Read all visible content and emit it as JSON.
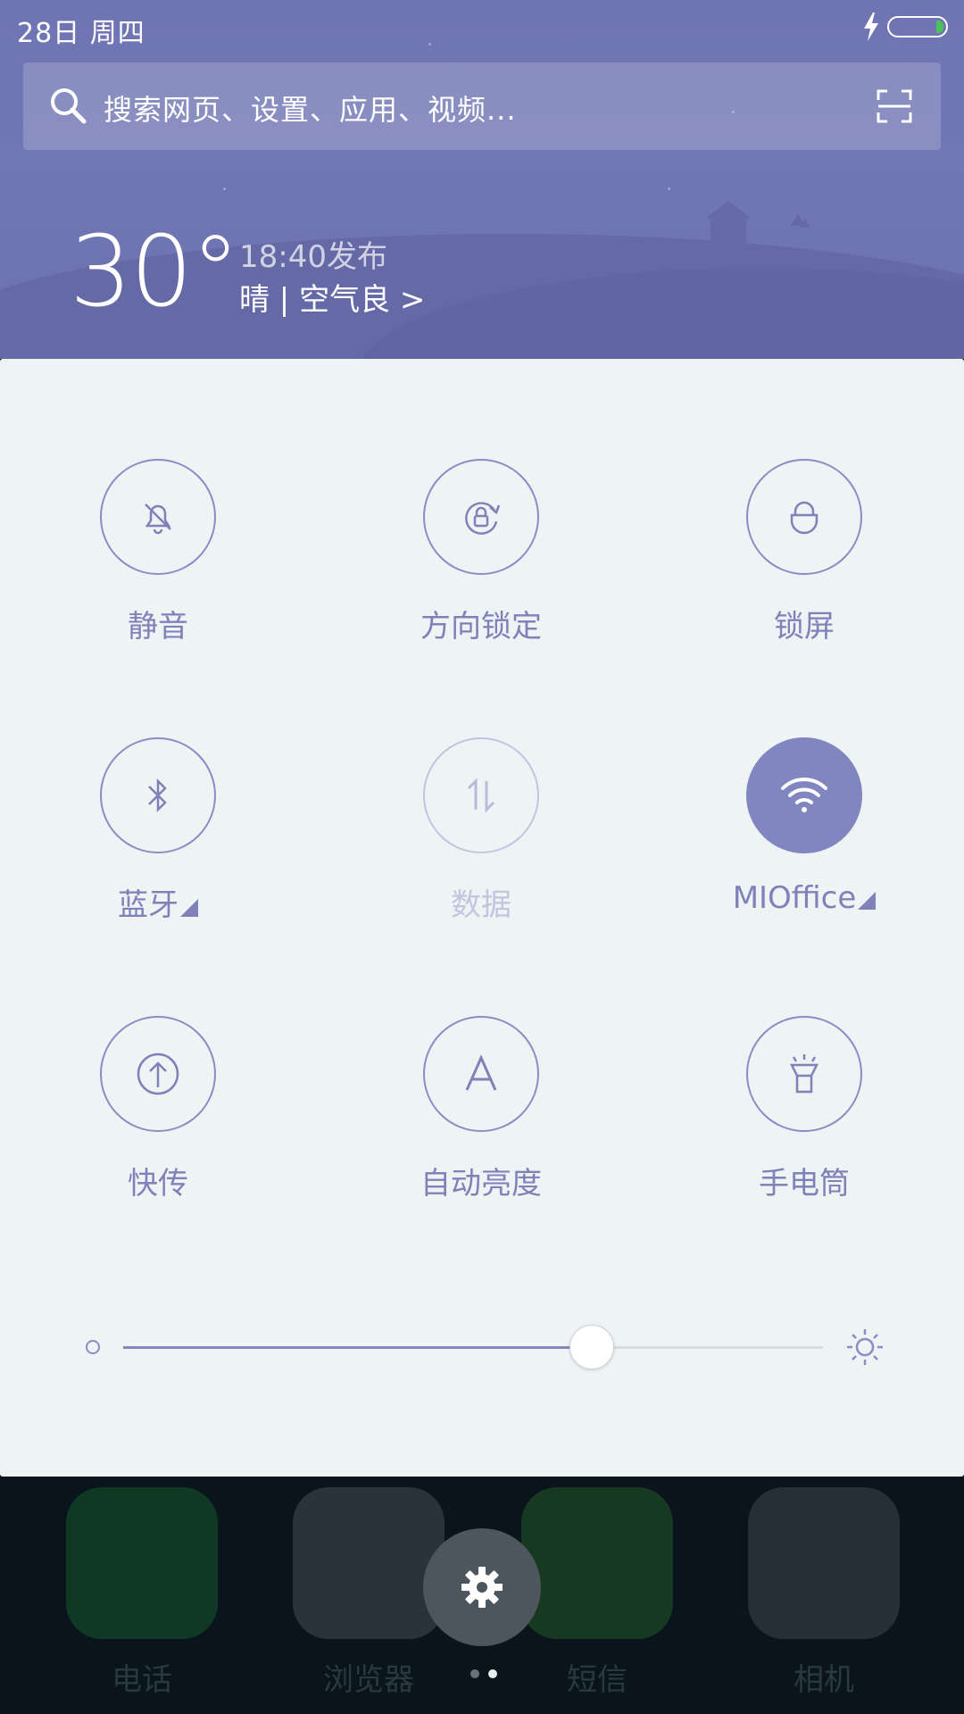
{
  "status_bar": {
    "date": "28日 周四"
  },
  "search": {
    "placeholder": "搜索网页、设置、应用、视频..."
  },
  "weather": {
    "temperature": "30°",
    "publish_time": "18:40发布",
    "condition": "晴 | 空气良 >"
  },
  "toggles": [
    {
      "label": "静音",
      "icon": "bell-off-icon",
      "state": "off"
    },
    {
      "label": "方向锁定",
      "icon": "rotation-lock-icon",
      "state": "off"
    },
    {
      "label": "锁屏",
      "icon": "lock-icon",
      "state": "off"
    },
    {
      "label": "蓝牙",
      "icon": "bluetooth-icon",
      "state": "off"
    },
    {
      "label": "数据",
      "icon": "mobile-data-icon",
      "state": "disabled"
    },
    {
      "label": "MIOffice",
      "icon": "wifi-icon",
      "state": "on"
    },
    {
      "label": "快传",
      "icon": "upload-icon",
      "state": "off"
    },
    {
      "label": "自动亮度",
      "icon": "auto-brightness-icon",
      "state": "off"
    },
    {
      "label": "手电筒",
      "icon": "flashlight-icon",
      "state": "off"
    }
  ],
  "brightness": {
    "level": 0.67
  },
  "dock": {
    "apps": [
      {
        "label": "电话",
        "icon": "phone-icon"
      },
      {
        "label": "浏览器",
        "icon": "browser-icon"
      },
      {
        "label": "短信",
        "icon": "messages-icon"
      },
      {
        "label": "相机",
        "icon": "camera-icon"
      }
    ],
    "page_indicator": {
      "count": 2,
      "active": 1
    }
  },
  "colors": {
    "accent": "#8286c0",
    "header": "#6f74b2",
    "panel": "#eef3f3"
  }
}
